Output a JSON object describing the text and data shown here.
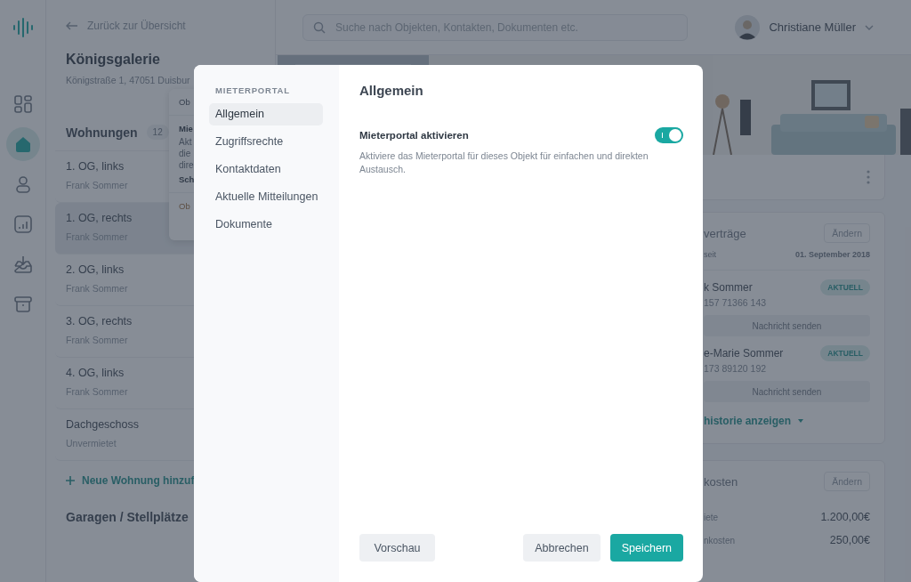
{
  "rail": {
    "items": [
      {
        "kind": "dashboard",
        "selected": false
      },
      {
        "kind": "home",
        "selected": true
      },
      {
        "kind": "person",
        "selected": false
      },
      {
        "kind": "chart",
        "selected": false
      },
      {
        "kind": "inbox",
        "selected": false
      },
      {
        "kind": "archive",
        "selected": false
      }
    ]
  },
  "list": {
    "back_link": "Zurück zur Übersicht",
    "title": "Königsgalerie",
    "address": "Königstraße 1, 47051 Duisbur",
    "section": {
      "title": "Wohnungen",
      "count": "12"
    },
    "rows": [
      {
        "title": "1. OG, links",
        "subtitle": "Frank Sommer",
        "selected": false
      },
      {
        "title": "1. OG, rechts",
        "subtitle": "Frank Sommer",
        "selected": true
      },
      {
        "title": "2. OG, links",
        "subtitle": "Frank Sommer",
        "selected": false
      },
      {
        "title": "3. OG, rechts",
        "subtitle": "Frank Sommer",
        "selected": false
      },
      {
        "title": "4. OG, links",
        "subtitle": "Frank Sommer",
        "selected": false
      },
      {
        "title": "Dachgeschoss",
        "subtitle": "Unvermietet",
        "selected": false
      }
    ],
    "add_link": "Neue Wohnung hinzuf",
    "section_2": "Garagen / Stellplätze"
  },
  "popover": {
    "items": [
      {
        "kind": "heading",
        "text": "Ob"
      },
      {
        "kind": "title",
        "text": "Mie"
      },
      {
        "kind": "line",
        "text": "Akt"
      },
      {
        "kind": "line",
        "text": "die"
      },
      {
        "kind": "line",
        "text": "dire"
      },
      {
        "kind": "title",
        "text": "Sch"
      },
      {
        "kind": "link",
        "text": "Ob"
      }
    ]
  },
  "topbar": {
    "search_placeholder": "Suche nach Objekten, Kontakten, Dokumenten etc.",
    "user_name": "Christiane Müller"
  },
  "contracts": {
    "title": "verträge",
    "edit": "Ändern",
    "since_label": "seit",
    "since_value": "01. September 2018",
    "tenants": [
      {
        "name": "k Sommer",
        "phone": "157 71366 143",
        "status": "AKTUELL",
        "action": "Nachricht senden"
      },
      {
        "name": "e-Marie Sommer",
        "phone": "173 89120 192",
        "status": "AKTUELL",
        "action": "Nachricht senden"
      }
    ],
    "history_link": "historie anzeigen"
  },
  "costs": {
    "title": "kosten",
    "edit": "Ändern",
    "rows": [
      {
        "label": "iete",
        "value": "1.200,00€"
      },
      {
        "label": "nkosten",
        "value": "250,00€"
      }
    ]
  },
  "modal": {
    "nav_heading": "MIETERPORTAL",
    "nav": [
      {
        "label": "Allgemein",
        "selected": true
      },
      {
        "label": "Zugriffsrechte",
        "selected": false
      },
      {
        "label": "Kontaktdaten",
        "selected": false
      },
      {
        "label": "Aktuelle Mitteilungen",
        "selected": false
      },
      {
        "label": "Dokumente",
        "selected": false
      }
    ],
    "title": "Allgemein",
    "setting": {
      "label": "Mieterportal aktivieren",
      "on": true,
      "description": "Aktiviere das Mieterportal für dieses Objekt für einfachen und direkten Austausch."
    },
    "buttons": [
      {
        "label": "Vorschau",
        "kind": "secondary"
      },
      {
        "label": "Abbrechen",
        "kind": "secondary"
      },
      {
        "label": "Speichern",
        "kind": "primary"
      }
    ]
  }
}
